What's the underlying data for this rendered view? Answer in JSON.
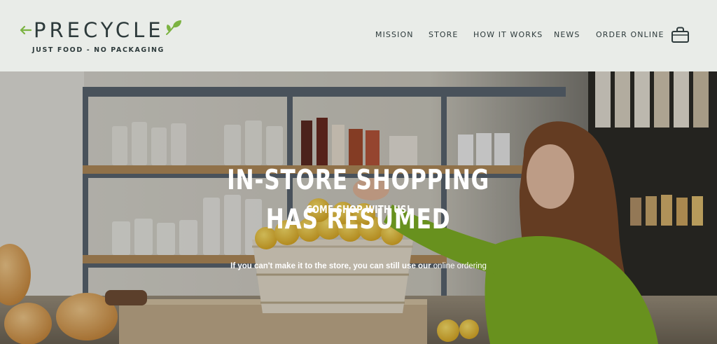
{
  "brand": {
    "name": "PRECYCLE",
    "tagline": "JUST FOOD - NO PACKAGING",
    "accent": "#7cb342",
    "text_color": "#2d3a3b"
  },
  "nav": {
    "items": [
      {
        "label": "MISSION"
      },
      {
        "label": "STORE"
      },
      {
        "label": "HOW IT WORKS"
      },
      {
        "label": "NEWS"
      },
      {
        "label": "ORDER ONLINE"
      }
    ],
    "cart_icon": "shopping-bag-icon"
  },
  "hero": {
    "eyebrow": "COME SHOP WITH US!",
    "headline_line1": "IN-STORE SHOPPING",
    "headline_line2": "HAS RESUMED",
    "subline_text": "If you can't make it to the store, you can still use our ",
    "subline_link": "online ordering"
  }
}
